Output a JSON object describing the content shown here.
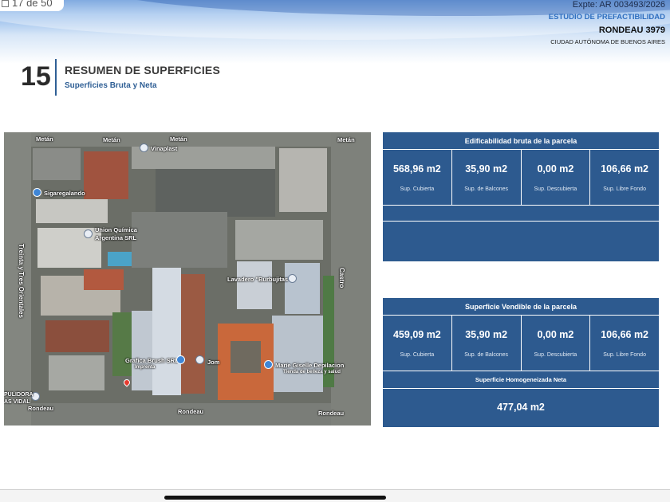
{
  "viewer": {
    "page_counter": "17 de 50"
  },
  "header": {
    "expte": "Expte: AR 003493/2026",
    "estudio": "ESTUDIO DE PREFACTIBILIDAD",
    "project": "RONDEAU 3979",
    "city": "CIUDAD AUTÓNOMA DE BUENOS AIRES"
  },
  "section": {
    "number": "15",
    "title": "RESUMEN DE SUPERFICIES",
    "subtitle": "Superficies Bruta y Neta"
  },
  "map": {
    "streets": {
      "metan_1": "Metán",
      "metan_2": "Metán",
      "metan_3": "Metán",
      "metan_4": "Metán",
      "rondeau_1": "Rondeau",
      "rondeau_2": "Rondeau",
      "rondeau_3": "Rondeau",
      "treinta_tres": "Treinta y Tres Orientales",
      "castro": "Castro"
    },
    "places": {
      "vinaplast": "Vinaplast",
      "sigaregalando": "Sigaregalando",
      "union_quimica_1": "Union Química",
      "union_quimica_2": "Argentina SRL",
      "lavadero": "Lavadero \"Burbujitas\"",
      "grafica_1": "Grafica Brush SRL",
      "grafica_2": "Imprenta",
      "jom": "Jom",
      "marie_1": "Marie Giselle Depilacion",
      "marie_2": "Tienda de belleza y salud",
      "pulidora_1": "PULIDORA",
      "pulidora_2": "AS VIDAL"
    }
  },
  "tables": {
    "bruta": {
      "title": "Edificabilidad bruta de la parcela",
      "cells": [
        {
          "value": "568,96 m2",
          "caption": "Sup. Cubierta"
        },
        {
          "value": "35,90 m2",
          "caption": "Sup. de Balcones"
        },
        {
          "value": "0,00 m2",
          "caption": "Sup. Descubierta"
        },
        {
          "value": "106,66 m2",
          "caption": "Sup. Libre Fondo"
        }
      ]
    },
    "vendible": {
      "title": "Superficie Vendible de la parcela",
      "cells": [
        {
          "value": "459,09 m2",
          "caption": "Sup. Cubierta"
        },
        {
          "value": "35,90 m2",
          "caption": "Sup. de Balcones"
        },
        {
          "value": "0,00 m2",
          "caption": "Sup. Descubierta"
        },
        {
          "value": "106,66 m2",
          "caption": "Sup. Libre Fondo"
        }
      ],
      "neta_title": "Superficie Homogeneizada Neta",
      "neta_value": "477,04 m2"
    }
  },
  "colors": {
    "table_bg": "#2d5a8f",
    "accent_blue": "#2f6fc0",
    "section_bar": "#2f5f95"
  }
}
